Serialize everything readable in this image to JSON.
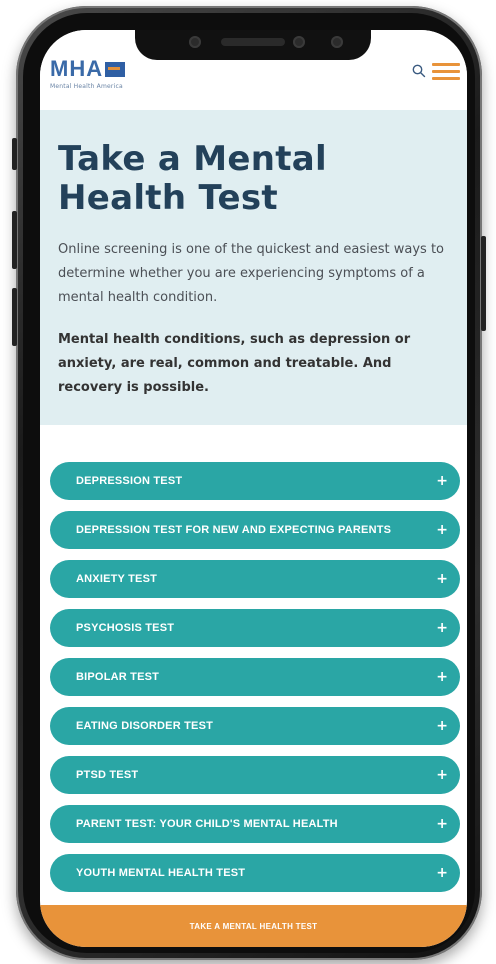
{
  "header": {
    "logo_text": "MHA",
    "logo_subtext": "Mental Health America",
    "icons": {
      "search": "search-icon",
      "menu": "hamburger-menu-icon"
    },
    "colors": {
      "brand_blue": "#3a6aa8",
      "accent_orange": "#e8933a"
    }
  },
  "hero": {
    "title": "Take a Mental Health Test",
    "intro": "Online screening is one of the quickest and easiest ways to determine whether you are experiencing symptoms of a mental health condition.",
    "note": "Mental health conditions, such as depression or anxiety, are real, common and treatable. And recovery is possible."
  },
  "tests": [
    {
      "label": "DEPRESSION TEST",
      "icon": "+"
    },
    {
      "label": "DEPRESSION TEST FOR NEW AND EXPECTING PARENTS",
      "icon": "+"
    },
    {
      "label": "ANXIETY TEST",
      "icon": "+"
    },
    {
      "label": "PSYCHOSIS TEST",
      "icon": "+"
    },
    {
      "label": "BIPOLAR TEST",
      "icon": "+"
    },
    {
      "label": "EATING DISORDER TEST",
      "icon": "+"
    },
    {
      "label": "PTSD TEST",
      "icon": "+"
    },
    {
      "label": "PARENT TEST: YOUR CHILD'S MENTAL HEALTH",
      "icon": "+"
    },
    {
      "label": "YOUTH MENTAL HEALTH TEST",
      "icon": "+"
    }
  ],
  "cta": {
    "label": "TAKE A MENTAL HEALTH TEST"
  },
  "colors": {
    "teal": "#2aa6a5",
    "hero_bg": "#e0eef1",
    "title": "#23415a"
  }
}
